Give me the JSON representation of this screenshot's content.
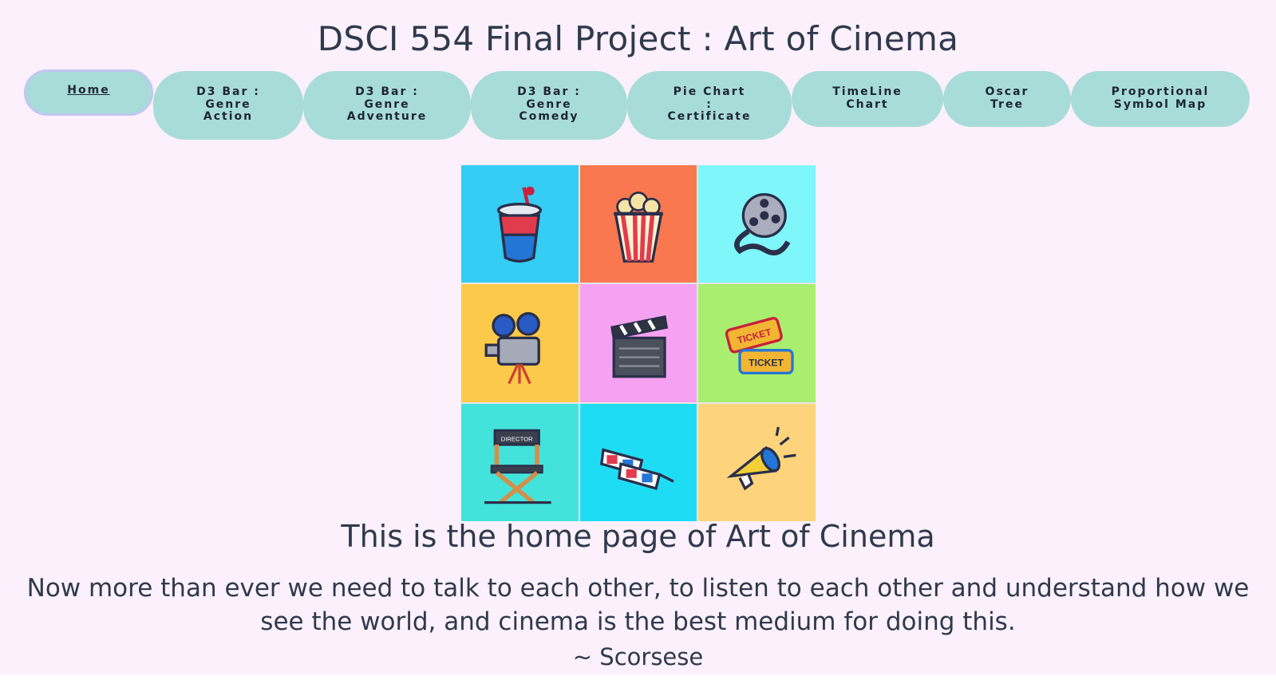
{
  "page": {
    "title": "DSCI 554 Final Project : Art of Cinema",
    "background": "#fbf0fb",
    "accent": "#a8dcd9"
  },
  "nav": {
    "items": [
      {
        "label": "Home",
        "active": true
      },
      {
        "label": "D3 Bar :\nGenre\nAction"
      },
      {
        "label": "D3 Bar :\nGenre\nAdventure"
      },
      {
        "label": "D3 Bar :\nGenre\nComedy"
      },
      {
        "label": "Pie Chart\n:\nCertificate"
      },
      {
        "label": "TimeLine\nChart"
      },
      {
        "label": "Oscar\nTree"
      },
      {
        "label": "Proportional\nSymbol Map"
      }
    ]
  },
  "collage": {
    "tiles": [
      {
        "icon": "soda-cup-icon",
        "bg": "#35cdf4"
      },
      {
        "icon": "popcorn-icon",
        "bg": "#f9784f"
      },
      {
        "icon": "film-reel-icon",
        "bg": "#7ff6fa"
      },
      {
        "icon": "movie-camera-icon",
        "bg": "#fcc94b"
      },
      {
        "icon": "clapperboard-icon",
        "bg": "#f6a2f2"
      },
      {
        "icon": "tickets-icon",
        "bg": "#a9ee6e"
      },
      {
        "icon": "director-chair-icon",
        "bg": "#43e3db"
      },
      {
        "icon": "3d-glasses-icon",
        "bg": "#1fdcf5"
      },
      {
        "icon": "megaphone-icon",
        "bg": "#fdd47c"
      }
    ],
    "chair_text": "DIRECTOR",
    "ticket_text": "TICKET"
  },
  "main": {
    "headline": "This is the home page of Art of Cinema",
    "quote_line1": "Now more than ever we need to talk to each other, to listen to each other and understand how we",
    "quote_line2": "see the world, and cinema is the best medium for doing this.",
    "author": "~ Scorsese"
  }
}
